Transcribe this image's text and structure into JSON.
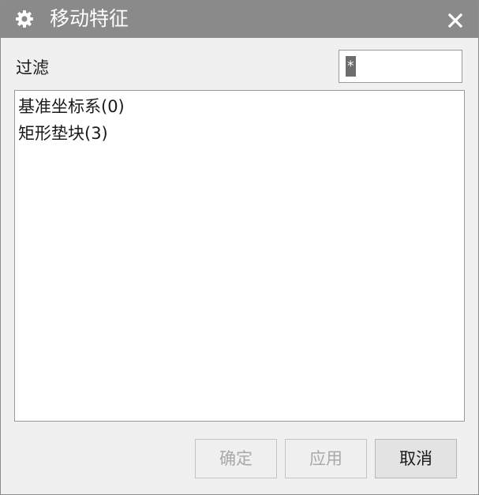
{
  "dialog": {
    "title": "移动特征",
    "title_icon": "gear-icon",
    "close_icon": "close-icon"
  },
  "filter": {
    "label": "过滤",
    "value": "*"
  },
  "feature_list": {
    "items": [
      {
        "label": "基准坐标系(0)"
      },
      {
        "label": "矩形垫块(3)"
      }
    ]
  },
  "buttons": {
    "ok_label": "确定",
    "ok_enabled": false,
    "apply_label": "应用",
    "apply_enabled": false,
    "cancel_label": "取消",
    "cancel_enabled": true
  },
  "colors": {
    "titlebar": "#8a8a8a",
    "dialog_bg": "#f0f0f0",
    "disabled_text": "#a8a8a8",
    "selection": "#6d6d6d"
  }
}
